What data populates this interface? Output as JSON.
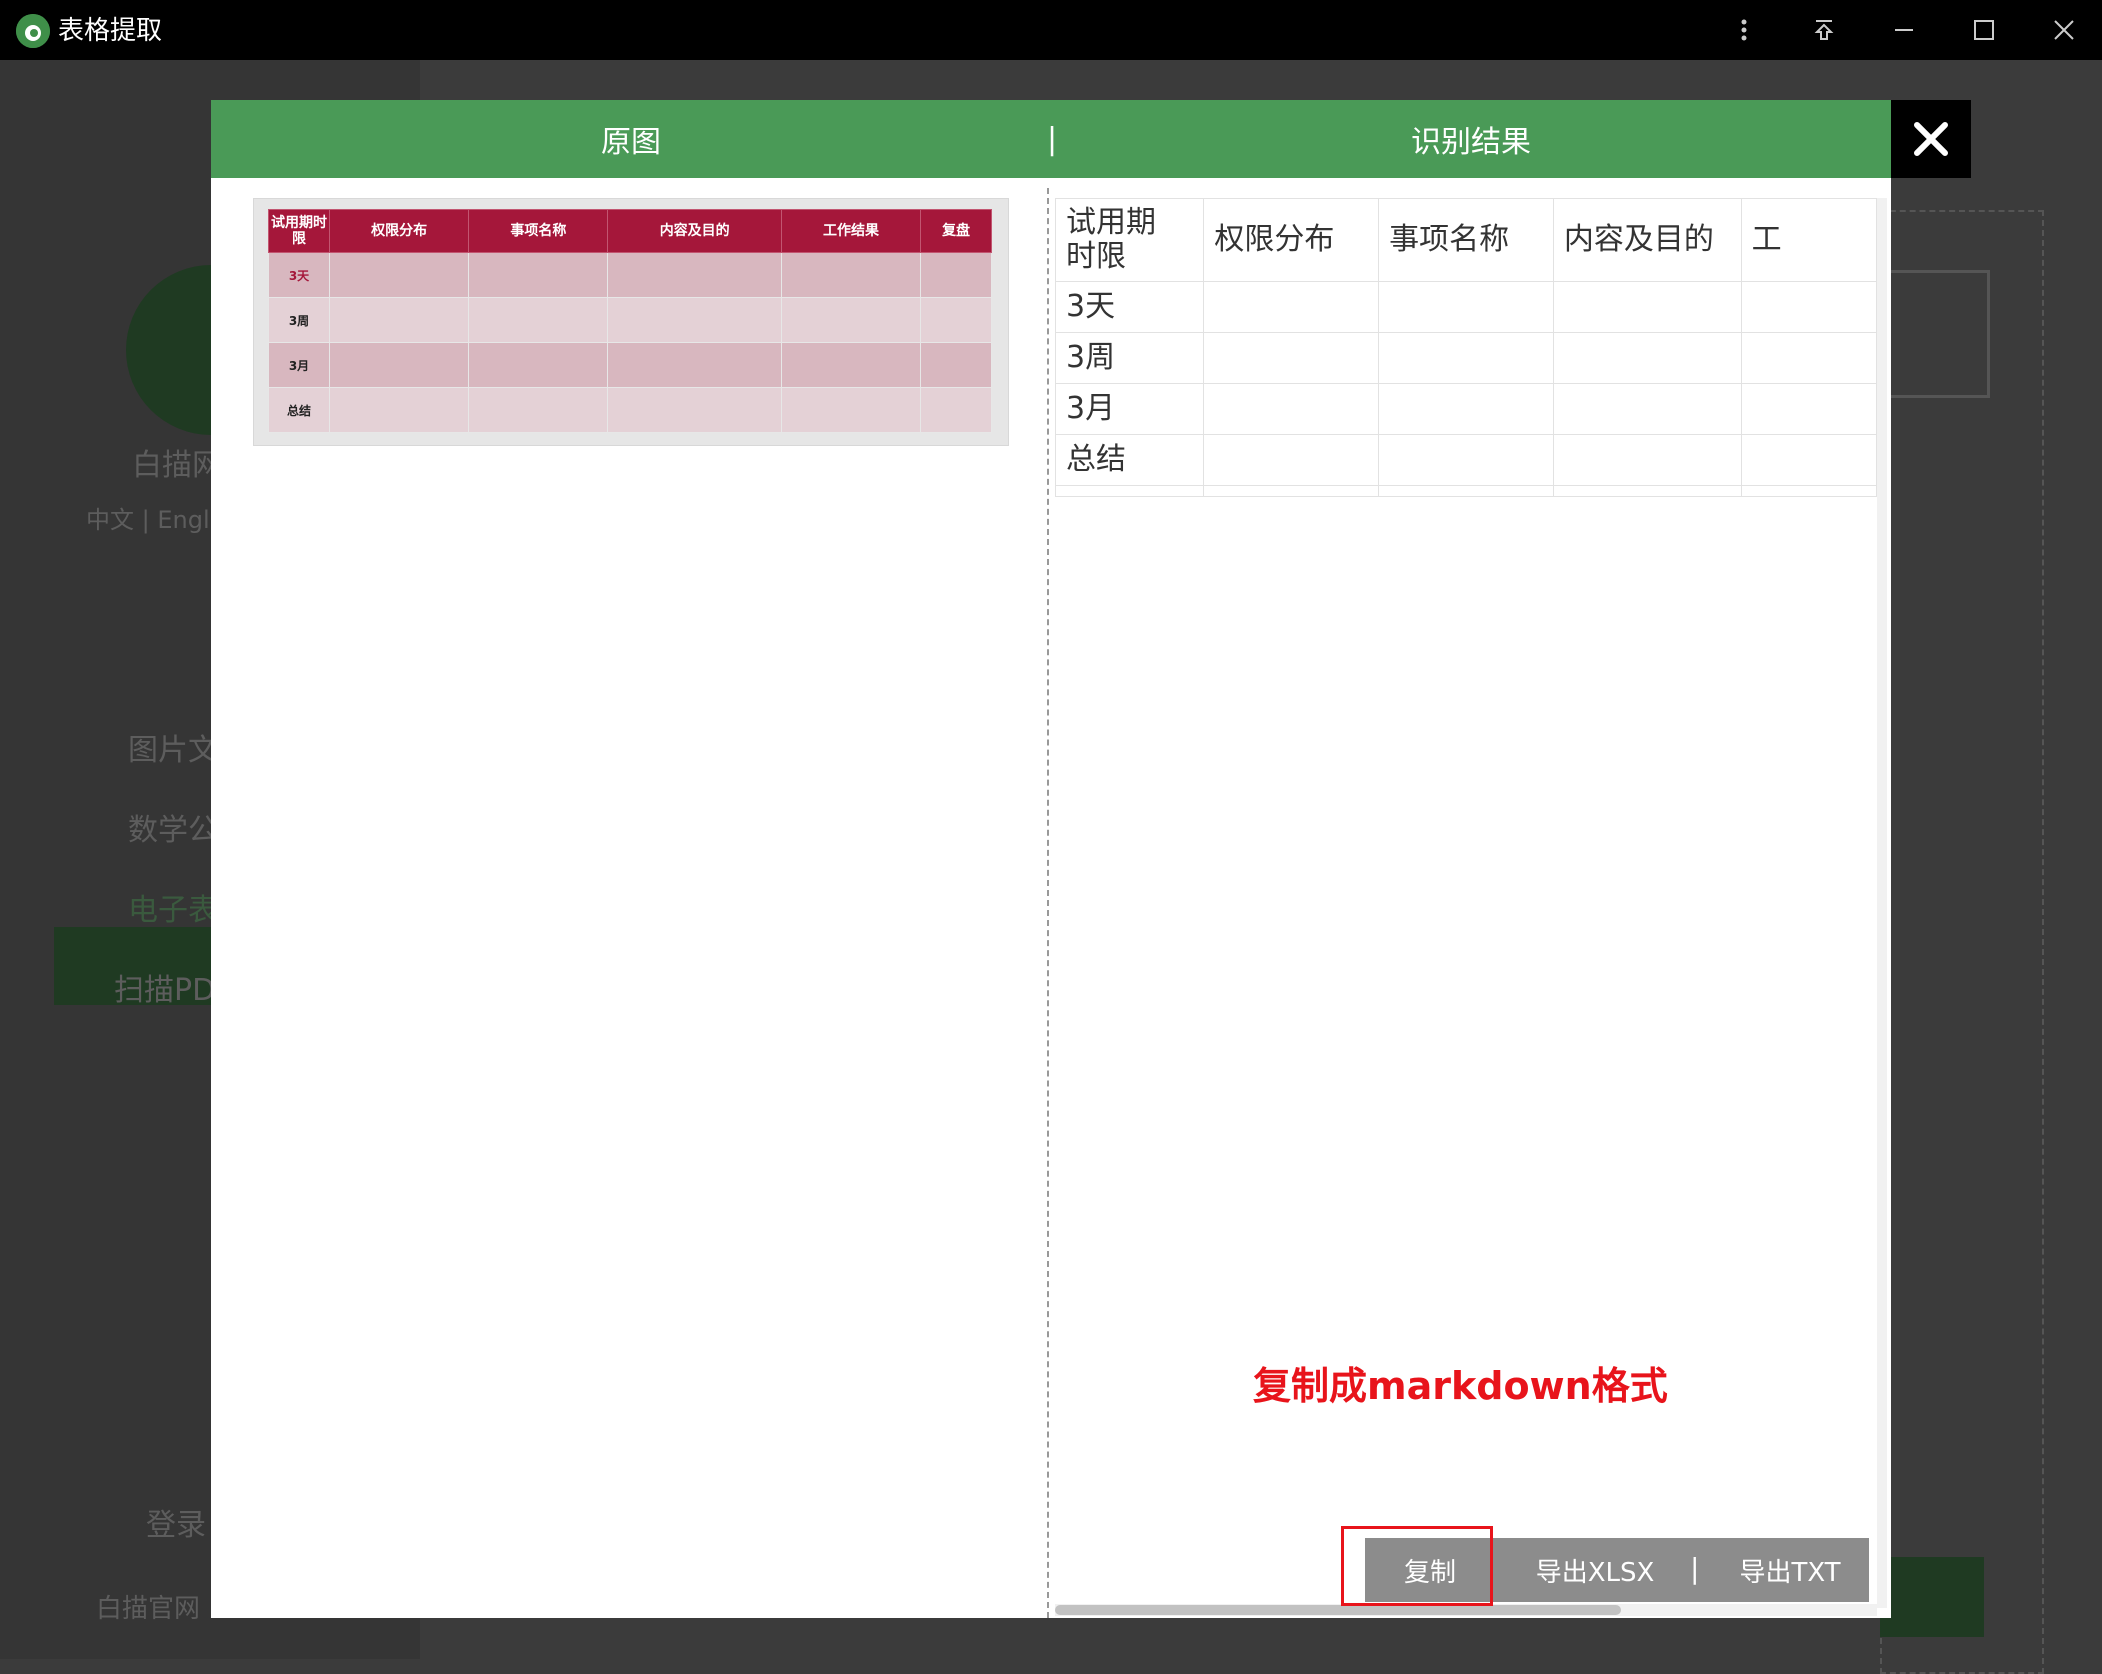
{
  "window": {
    "title": "表格提取"
  },
  "background": {
    "brand": "白描网",
    "lang": "中文 | Engli",
    "menu": [
      "图片文",
      "数学公",
      "电子表",
      "扫描PD"
    ],
    "login": "登录",
    "site": "白描官网"
  },
  "modal": {
    "tab_original": "原图",
    "tab_result": "识别结果",
    "separator": "|"
  },
  "original_table": {
    "headers": [
      "试用期时限",
      "权限分布",
      "事项名称",
      "内容及目的",
      "工作结果",
      "复盘"
    ],
    "rows": [
      "3天",
      "3周",
      "3月",
      "总结"
    ]
  },
  "result_table": {
    "headers": [
      "试用期\n时限",
      "权限分布",
      "事项名称",
      "内容及目的",
      "工"
    ],
    "rows": [
      "3天",
      "3周",
      "3月",
      "总结"
    ]
  },
  "annotation": "复制成markdown格式",
  "actions": {
    "copy": "复制",
    "export_xlsx": "导出XLSX",
    "separator": "|",
    "export_txt": "导出TXT"
  },
  "colors": {
    "header_green": "#4a9a57",
    "table_header_red": "#a5173a",
    "annotation_red": "#e8141b"
  }
}
